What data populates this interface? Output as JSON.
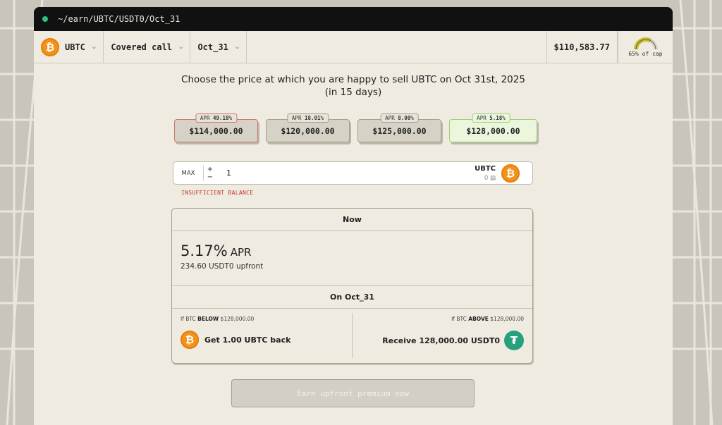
{
  "window": {
    "path": "~/earn/UBTC/USDT0/Oct_31"
  },
  "toolbar": {
    "asset": "UBTC",
    "strategy": "Covered call",
    "expiry": "Oct_31",
    "price": "$110,583.77",
    "cap_label": "65% of cap",
    "cap_fraction": 0.65
  },
  "main": {
    "heading_line1": "Choose the price at which you are happy to sell UBTC on Oct 31st, 2025",
    "heading_line2": "(in 15 days)",
    "strikes": [
      {
        "apr_label": "APR",
        "apr": "49.18%",
        "price": "$114,000.00"
      },
      {
        "apr_label": "APR",
        "apr": "18.01%",
        "price": "$120,000.00"
      },
      {
        "apr_label": "APR",
        "apr": "8.08%",
        "price": "$125,000.00"
      },
      {
        "apr_label": "APR",
        "apr": "5.18%",
        "price": "$128,000.00"
      }
    ],
    "amount": {
      "max_label": "MAX",
      "plus": "+",
      "minus": "−",
      "value": "1",
      "symbol": "UBTC",
      "balance": "0"
    },
    "error": "INSUFFICIENT BALANCE",
    "summary": {
      "now_title": "Now",
      "apr_value": "5.17%",
      "apr_unit": "APR",
      "upfront": "234.60 USDT0 upfront",
      "on_title": "On Oct_31",
      "below_prefix": "If BTC",
      "below_word": "BELOW",
      "below_price": "$128,000.00",
      "below_result": "Get 1.00 UBTC back",
      "above_prefix": "If BTC",
      "above_word": "ABOVE",
      "above_price": "$128,000.00",
      "above_result": "Receive 128,000.00 USDT0"
    },
    "cta": "Earn upfront premium now"
  },
  "colors": {
    "btc": "#f2921c",
    "tether": "#26a17b",
    "error": "#c0392b",
    "selected_bg": "#ecf6dc"
  }
}
